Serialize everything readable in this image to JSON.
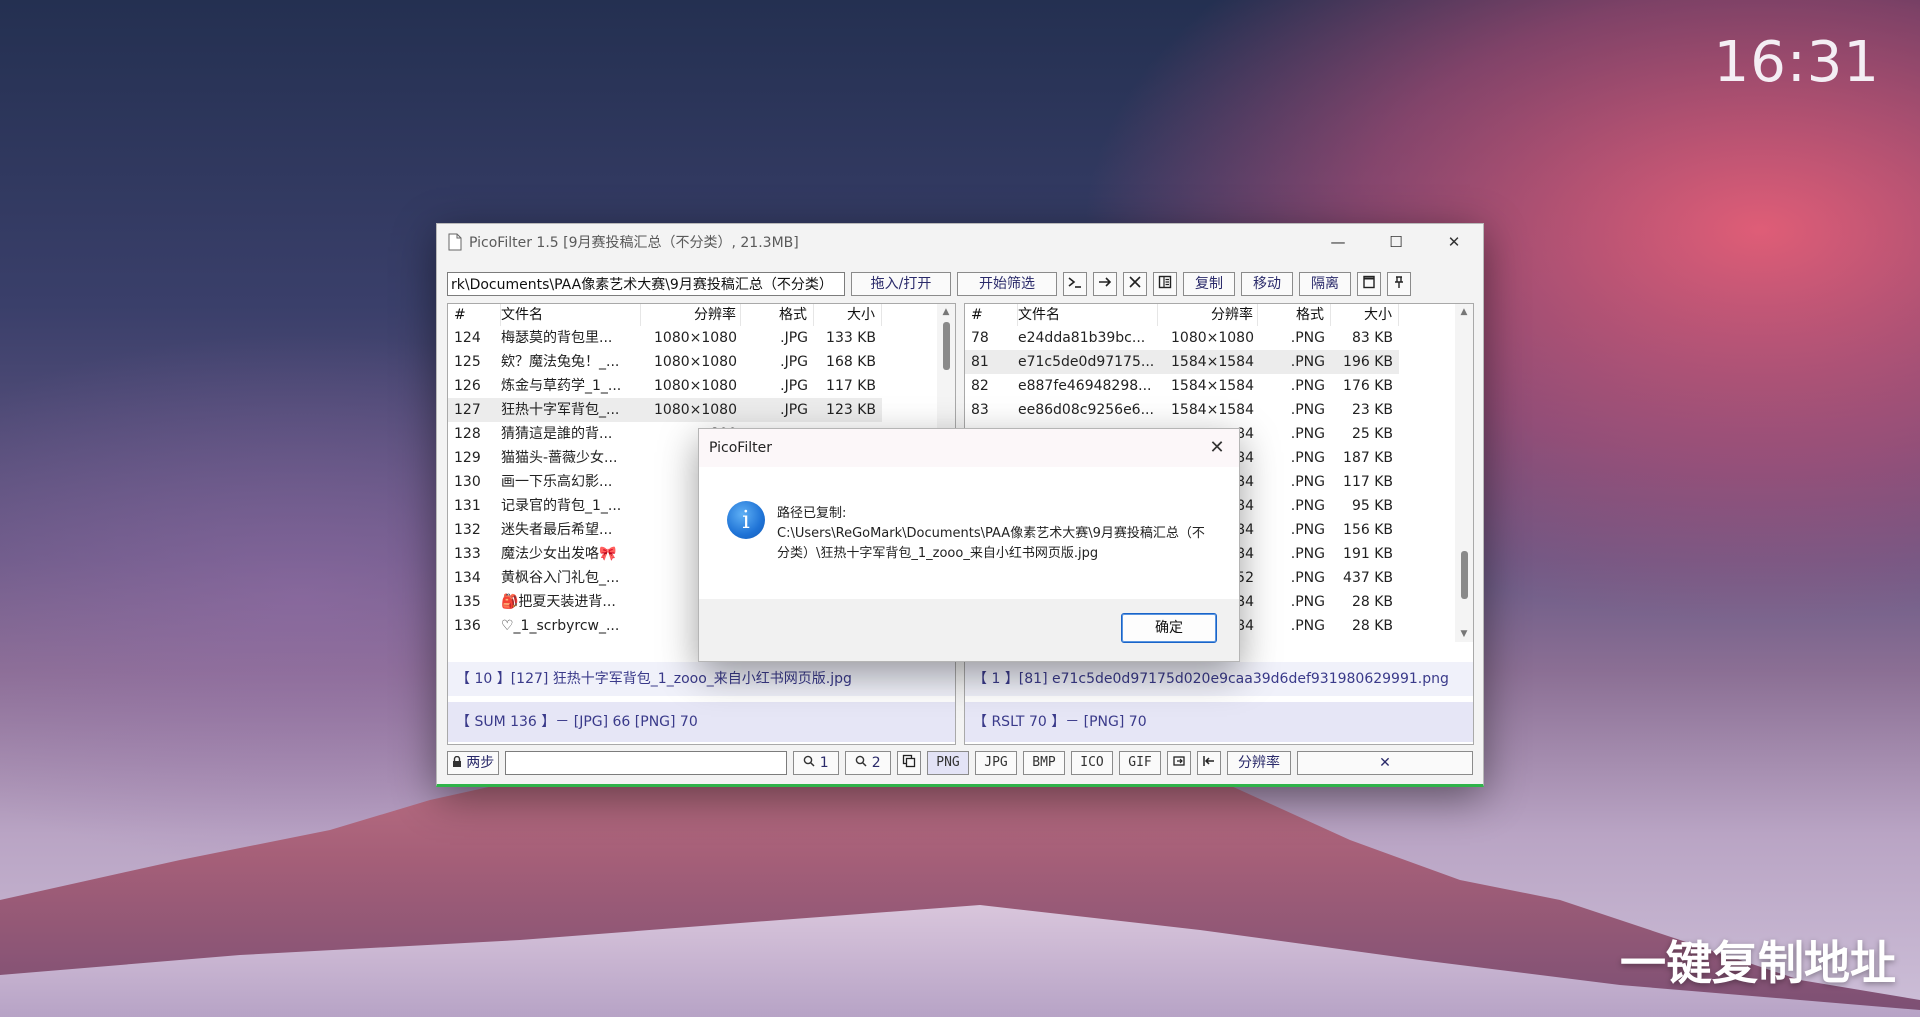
{
  "clock": "16:31",
  "caption": "一键复制地址",
  "window": {
    "title": "PicoFilter 1.5  [9月赛投稿汇总（不分类）, 21.3MB]",
    "controls": {
      "minimize": "—",
      "maximize": "☐",
      "close": "✕"
    }
  },
  "toolbar": {
    "path": "rk\\Documents\\PAA像素艺术大赛\\9月赛投稿汇总（不分类）",
    "drag_open": "拖入/打开",
    "start_filter": "开始筛选",
    "terminal_icon": "terminal-icon",
    "arrow_icon": "arrow-right-icon",
    "delete_icon": "delete-icon",
    "panel_icon": "panel-icon",
    "copy": "复制",
    "move": "移动",
    "isolate": "隔离",
    "window_icon": "window-icon",
    "pin_icon": "pin-icon"
  },
  "columns": {
    "idx": "#",
    "name": "文件名",
    "res": "分辨率",
    "fmt": "格式",
    "size": "大小"
  },
  "left_list": {
    "rows": [
      {
        "idx": "124",
        "name": "梅瑟莫的背包里...",
        "res": "1080×1080",
        "fmt": ".JPG",
        "size": "133 KB"
      },
      {
        "idx": "125",
        "name": "欸？魔法兔兔！_...",
        "res": "1080×1080",
        "fmt": ".JPG",
        "size": "168 KB"
      },
      {
        "idx": "126",
        "name": "炼金与草药学_1_...",
        "res": "1080×1080",
        "fmt": ".JPG",
        "size": "117 KB"
      },
      {
        "idx": "127",
        "name": "狂热十字军背包_...",
        "res": "1080×1080",
        "fmt": ".JPG",
        "size": "123 KB",
        "selected": true
      },
      {
        "idx": "128",
        "name": "猜猜這是誰的背...",
        "res": "800",
        "fmt": "",
        "size": ""
      },
      {
        "idx": "129",
        "name": "猫猫头-蔷薇少女...",
        "res": "1584",
        "fmt": "",
        "size": ""
      },
      {
        "idx": "130",
        "name": "画一下乐高幻影...",
        "res": "1080",
        "fmt": "",
        "size": ""
      },
      {
        "idx": "131",
        "name": "记录官的背包_1_...",
        "res": "1080",
        "fmt": "",
        "size": ""
      },
      {
        "idx": "132",
        "name": "迷失者最后希望...",
        "res": "1080",
        "fmt": "",
        "size": ""
      },
      {
        "idx": "133",
        "name": "魔法少女出发咯🎀",
        "res": "1080",
        "fmt": "",
        "size": ""
      },
      {
        "idx": "134",
        "name": "黄枫谷入门礼包_...",
        "res": "1080",
        "fmt": "",
        "size": ""
      },
      {
        "idx": "135",
        "name": "🎒把夏天装进背...",
        "res": "1080",
        "fmt": "",
        "size": ""
      },
      {
        "idx": "136",
        "name": "♡_1_scrbyrcw_...",
        "res": "1080",
        "fmt": "",
        "size": ""
      }
    ],
    "info": "【 10 】[127]  狂热十字军背包_1_zooo_来自小红书网页版.jpg",
    "sum": "【 SUM 136 】－ [JPG] 66  [PNG] 70",
    "scroll_fraction": 0.0
  },
  "right_list": {
    "rows": [
      {
        "idx": "78",
        "name": "e24dda81b39bc...",
        "res": "1080×1080",
        "fmt": ".PNG",
        "size": "83 KB"
      },
      {
        "idx": "81",
        "name": "e71c5de0d97175...",
        "res": "1584×1584",
        "fmt": ".PNG",
        "size": "196 KB",
        "selected": true
      },
      {
        "idx": "82",
        "name": "e887fe46948298...",
        "res": "1584×1584",
        "fmt": ".PNG",
        "size": "176 KB"
      },
      {
        "idx": "83",
        "name": "ee86d08c9256e6...",
        "res": "1584×1584",
        "fmt": ".PNG",
        "size": "23 KB"
      },
      {
        "idx": "",
        "name": "",
        "res": "84",
        "fmt": ".PNG",
        "size": "25 KB"
      },
      {
        "idx": "",
        "name": "",
        "res": "84",
        "fmt": ".PNG",
        "size": "187 KB"
      },
      {
        "idx": "",
        "name": "",
        "res": "84",
        "fmt": ".PNG",
        "size": "117 KB"
      },
      {
        "idx": "",
        "name": "",
        "res": "84",
        "fmt": ".PNG",
        "size": "95 KB"
      },
      {
        "idx": "",
        "name": "",
        "res": "84",
        "fmt": ".PNG",
        "size": "156 KB"
      },
      {
        "idx": "",
        "name": "",
        "res": "84",
        "fmt": ".PNG",
        "size": "191 KB"
      },
      {
        "idx": "",
        "name": "",
        "res": "52",
        "fmt": ".PNG",
        "size": "437 KB"
      },
      {
        "idx": "",
        "name": "",
        "res": "84",
        "fmt": ".PNG",
        "size": "28 KB"
      },
      {
        "idx": "",
        "name": "",
        "res": "84",
        "fmt": ".PNG",
        "size": "28 KB"
      }
    ],
    "info": "【 1 】[81]  e71c5de0d97175d020e9caa39d6def931980629991.png",
    "sum": "【 RSLT 70 】－ [PNG] 70",
    "scroll_fraction": 0.9
  },
  "bottombar": {
    "two_step": "两步",
    "filter_value": "",
    "search1": "1",
    "search2": "2",
    "formats": [
      "PNG",
      "JPG",
      "BMP",
      "ICO",
      "GIF"
    ],
    "resolution": "分辨率",
    "clear": "✕"
  },
  "dialog": {
    "title": "PicoFilter",
    "close": "✕",
    "icon": "i",
    "line1": "路径已复制:",
    "line2": "C:\\Users\\ReGoMark\\Documents\\PAA像素艺术大赛\\9月赛投稿汇总（不分类）\\狂热十字军背包_1_zooo_来自小红书网页版.jpg",
    "ok": "确定"
  },
  "colors": {
    "accent": "#2fb34a",
    "link": "#3a3a8a",
    "dialog_button": "#1a64c8"
  }
}
